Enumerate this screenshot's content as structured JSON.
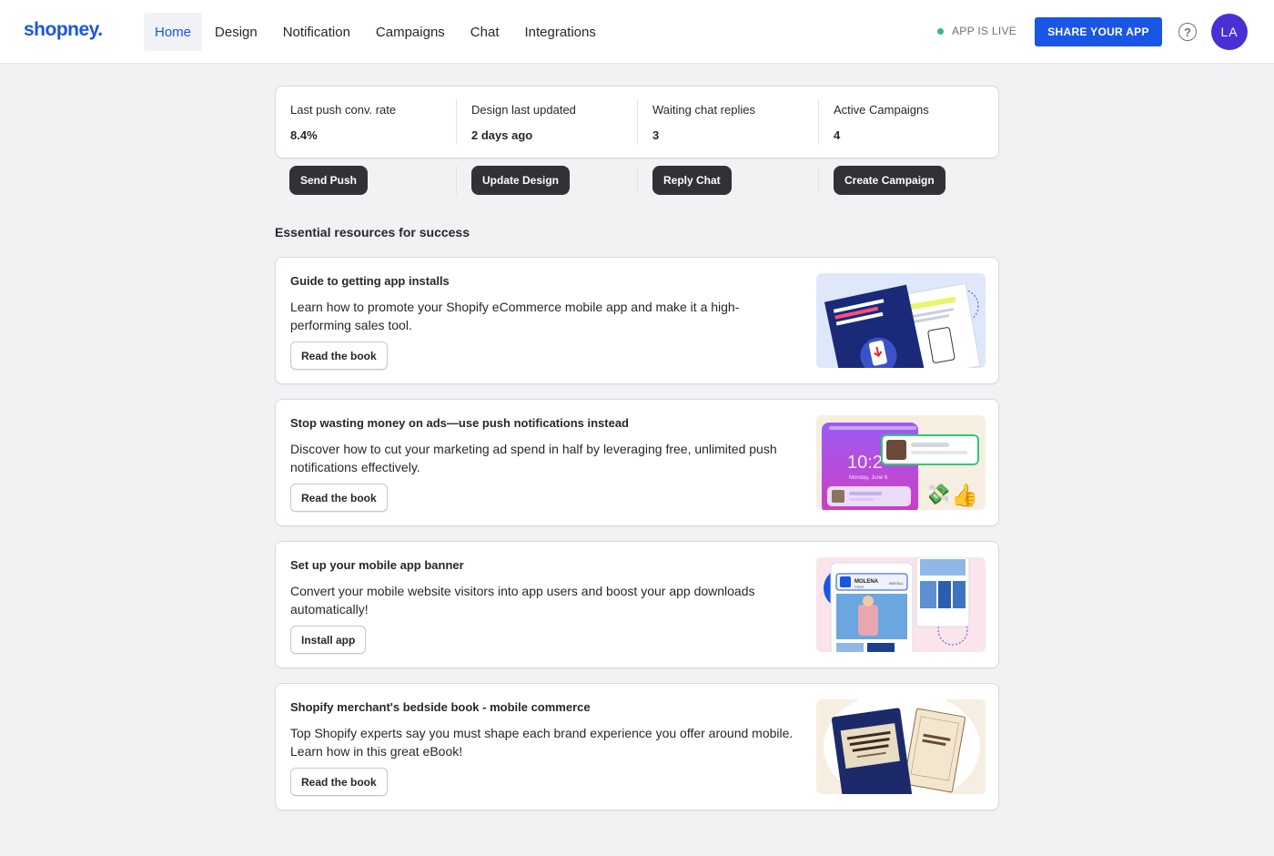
{
  "app": {
    "logo": "shopney."
  },
  "nav": {
    "items": [
      {
        "label": "Home",
        "active": true
      },
      {
        "label": "Design"
      },
      {
        "label": "Notification"
      },
      {
        "label": "Campaigns"
      },
      {
        "label": "Chat"
      },
      {
        "label": "Integrations"
      }
    ]
  },
  "header": {
    "status": "APP IS LIVE",
    "share_label": "SHARE YOUR APP",
    "help_glyph": "?",
    "avatar_initials": "LA",
    "colors": {
      "brand": "#1a56e6",
      "live": "#2bbf7a",
      "avatar": "#4b2fd6"
    }
  },
  "stats": [
    {
      "label": "Last push conv. rate",
      "value": "8.4%",
      "action": "Send Push"
    },
    {
      "label": "Design last updated",
      "value": "2 days ago",
      "action": "Update Design"
    },
    {
      "label": "Waiting chat replies",
      "value": "3",
      "action": "Reply Chat"
    },
    {
      "label": "Active Campaigns",
      "value": "4",
      "action": "Create Campaign"
    }
  ],
  "resources": {
    "title": "Essential resources for success",
    "items": [
      {
        "title": "Guide to getting app installs",
        "description": "Learn how to promote your Shopify eCommerce mobile app and make it a high-performing sales tool.",
        "button": "Read the book",
        "thumb_icon": "ebook-cover-getting-downloads"
      },
      {
        "title": "Stop wasting money on ads—use push notifications instead",
        "description": "Discover how to cut your marketing ad spend in half by leveraging free, unlimited push notifications effectively.",
        "button": "Read the book",
        "thumb_icon": "phone-lockscreen-push-notification",
        "thumb_text": {
          "time": "10:2",
          "date": "Monday, June 6"
        }
      },
      {
        "title": "Set up your mobile app banner",
        "description": "Convert your mobile website visitors into app users and boost your app downloads automatically!",
        "button": "Install app",
        "thumb_icon": "mobile-app-banner-preview",
        "thumb_text": {
          "brand": "MOLENA",
          "sub": "FREE",
          "cta": "INSTALL"
        }
      },
      {
        "title": "Shopify merchant's bedside book - mobile commerce",
        "description": "Top Shopify experts say you must shape each brand experience you offer around mobile. Learn how in this great eBook!",
        "button": "Read the book",
        "thumb_icon": "ebook-covers-mobile-commerce"
      }
    ]
  }
}
